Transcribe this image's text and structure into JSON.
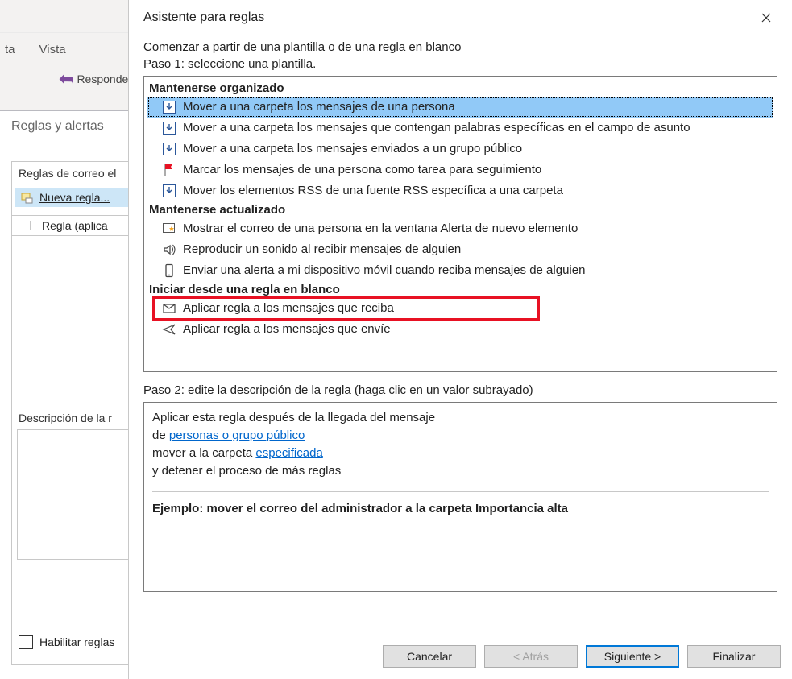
{
  "background": {
    "tab1": "ta",
    "tab2": "Vista",
    "ribbon_responder": "Responde",
    "breadcrumb": "Reglas y alertas",
    "panel": {
      "heading": "Reglas de correo el",
      "new_rule": "Nueva regla...",
      "col_rule": "Regla (aplica",
      "desc_label": "Descripción de la r",
      "enable_rules": "Habilitar reglas"
    }
  },
  "dialog": {
    "title": "Asistente para reglas",
    "intro": "Comenzar a partir de una plantilla o de una regla en blanco",
    "step1": "Paso 1: seleccione una plantilla.",
    "sections": {
      "organized": "Mantenerse organizado",
      "updated": "Mantenerse actualizado",
      "blank": "Iniciar desde una regla en blanco"
    },
    "items": {
      "org1": "Mover a una carpeta los mensajes de una persona",
      "org2": "Mover a una carpeta los mensajes que contengan palabras específicas en el campo de asunto",
      "org3": "Mover a una carpeta los mensajes enviados a un grupo público",
      "org4": "Marcar los mensajes de una persona como tarea para seguimiento",
      "org5": "Mover los elementos RSS de una fuente RSS específica a una carpeta",
      "upd1": "Mostrar el correo de una persona en la ventana Alerta de nuevo elemento",
      "upd2": "Reproducir un sonido al recibir mensajes de alguien",
      "upd3": "Enviar una alerta a mi dispositivo móvil cuando reciba mensajes de alguien",
      "blk1": "Aplicar regla a los mensajes que reciba",
      "blk2": "Aplicar regla a los mensajes que envíe"
    },
    "step2": "Paso 2: edite la descripción de la regla (haga clic en un valor subrayado)",
    "desc": {
      "line1": "Aplicar esta regla después de la llegada del mensaje",
      "line2_pre": "de ",
      "line2_link": "personas o grupo público",
      "line3_pre": "mover a la carpeta ",
      "line3_link": "especificada",
      "line4": " y detener el proceso de más reglas",
      "example": "Ejemplo: mover el correo del administrador a la carpeta Importancia alta"
    },
    "buttons": {
      "cancel": "Cancelar",
      "back": "< Atrás",
      "next": "Siguiente >",
      "finish": "Finalizar"
    }
  }
}
